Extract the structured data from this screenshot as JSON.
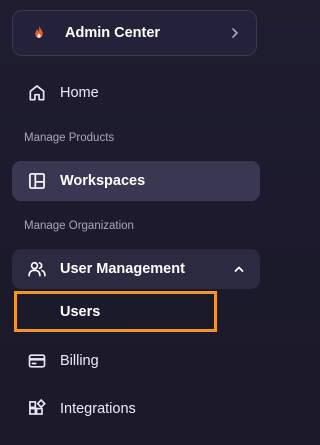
{
  "app": {
    "title": "Admin Center",
    "logo_icon": "flame-icon",
    "accent_color": "#f05a28",
    "highlight_color": "#f0962b"
  },
  "nav": {
    "home": {
      "label": "Home",
      "icon": "home-icon"
    },
    "section_products": "Manage Products",
    "workspaces": {
      "label": "Workspaces",
      "icon": "layout-icon",
      "active": true
    },
    "section_org": "Manage Organization",
    "user_management": {
      "label": "User Management",
      "icon": "users-icon",
      "expanded": true,
      "children": [
        {
          "label": "Users"
        }
      ]
    },
    "billing": {
      "label": "Billing",
      "icon": "credit-card-icon"
    },
    "integrations": {
      "label": "Integrations",
      "icon": "puzzle-icon"
    }
  }
}
